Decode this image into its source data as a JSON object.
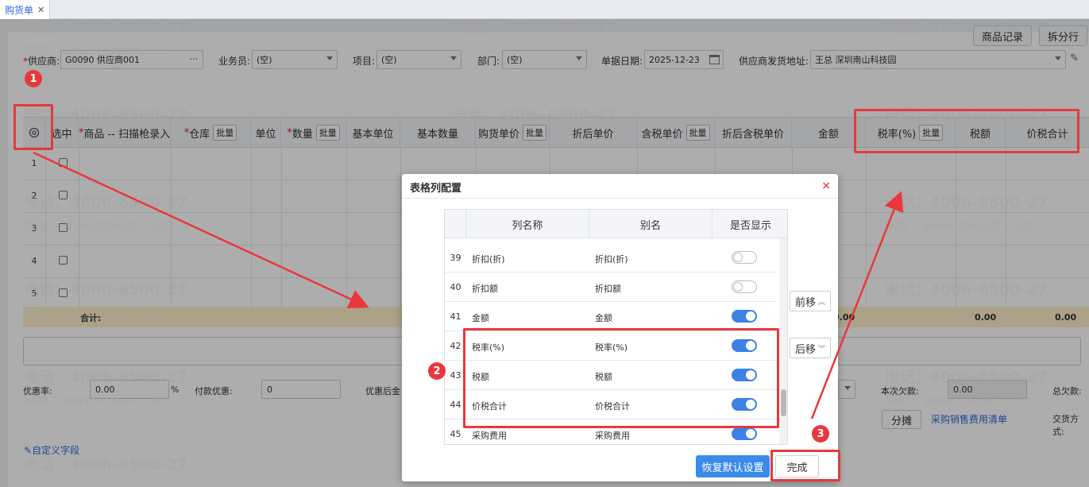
{
  "tab": {
    "title": "购货单",
    "close": "✕"
  },
  "top_buttons": {
    "product_record": "商品记录",
    "split_row": "拆分行"
  },
  "form": {
    "supplier_label": "供应商:",
    "supplier_value": "G0090 供应商001",
    "supplier_more": "···",
    "salesman_label": "业务员:",
    "salesman_value": "(空)",
    "project_label": "项目:",
    "project_value": "(空)",
    "dept_label": "部门:",
    "dept_value": "(空)",
    "date_label": "单据日期:",
    "date_value": "2025-12-23",
    "address_label": "供应商发货地址:",
    "address_value": "王总 深圳南山科技园"
  },
  "grid": {
    "headers": [
      "选中",
      "商品 -- 扫描枪录入",
      "仓库",
      "单位",
      "数量",
      "基本单位",
      "基本数量",
      "购货单价",
      "折后单价",
      "含税单价",
      "折后含税单价",
      "金额",
      "税率(%)",
      "税额",
      "价税合计"
    ],
    "batch_label": "批量",
    "rows": [
      "1",
      "2",
      "3",
      "4",
      "5"
    ],
    "sum_label": "合计:",
    "sum_values": [
      "0.00",
      "0.00",
      "0.00"
    ]
  },
  "bottom": {
    "discount_rate_label": "优惠率:",
    "discount_rate_value": "0.00",
    "percent": "%",
    "pay_discount_label": "付款优惠:",
    "pay_discount_value": "0",
    "after_discount_label": "优惠后金",
    "current_debt_label": "本次欠款:",
    "current_debt_value": "0.00",
    "total_debt_label": "总欠款:",
    "split_button": "分摊",
    "expense_link": "采购销售费用清单",
    "trade_label": "交货方式:",
    "custom_field": "自定义字段"
  },
  "dialog": {
    "title": "表格列配置",
    "close": "×",
    "headers": [
      "列名称",
      "别名",
      "是否显示"
    ],
    "rows": [
      {
        "idx": "39",
        "name": "折扣(折)",
        "alias": "折扣(折)",
        "show": false
      },
      {
        "idx": "40",
        "name": "折扣额",
        "alias": "折扣额",
        "show": false
      },
      {
        "idx": "41",
        "name": "金额",
        "alias": "金额",
        "show": true
      },
      {
        "idx": "42",
        "name": "税率(%)",
        "alias": "税率(%)",
        "show": true
      },
      {
        "idx": "43",
        "name": "税额",
        "alias": "税额",
        "show": true
      },
      {
        "idx": "44",
        "name": "价税合计",
        "alias": "价税合计",
        "show": true
      },
      {
        "idx": "45",
        "name": "采购费用",
        "alias": "采购费用",
        "show": true
      }
    ],
    "move_up": "前移",
    "move_down": "后移",
    "restore_default": "恢复默认设置",
    "done": "完成"
  },
  "annotations": {
    "step1": "1",
    "step2": "2",
    "step3": "3"
  },
  "watermark": {
    "phone": "电话：4006-6500-27",
    "site": "网址：www.tdxsoft.com"
  },
  "colors": {
    "annotation_red": "#e8383d",
    "toggle_on": "#3b82e6",
    "primary": "#3b8be8"
  }
}
